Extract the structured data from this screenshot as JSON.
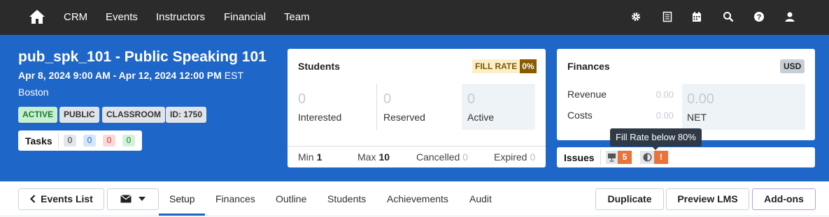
{
  "nav": {
    "home_icon": "home-icon",
    "links": [
      "CRM",
      "Events",
      "Instructors",
      "Financial",
      "Team"
    ],
    "icons": [
      "gear-icon",
      "document-icon",
      "calendar-icon",
      "search-icon",
      "help-icon",
      "user-icon"
    ]
  },
  "event": {
    "title": "pub_spk_101 - Public Speaking 101",
    "dates": "Apr 8, 2024 9:00 AM - Apr 12, 2024 12:00 PM",
    "timezone": "EST",
    "location": "Boston",
    "badges": [
      "ACTIVE",
      "PUBLIC",
      "CLASSROOM",
      "ID: 1750"
    ]
  },
  "tasks": {
    "label": "Tasks",
    "counts": [
      "0",
      "0",
      "0",
      "0"
    ]
  },
  "students": {
    "title": "Students",
    "fill_rate_label": "FILL RATE",
    "fill_rate_value": "0%",
    "stats": [
      {
        "value": "0",
        "label": "Interested"
      },
      {
        "value": "0",
        "label": "Reserved"
      },
      {
        "value": "0",
        "label": "Active"
      }
    ],
    "footer": {
      "min_label": "Min",
      "min_value": "1",
      "max_label": "Max",
      "max_value": "10",
      "cancelled_label": "Cancelled",
      "cancelled_value": "0",
      "expired_label": "Expired",
      "expired_value": "0"
    }
  },
  "finances": {
    "title": "Finances",
    "currency": "USD",
    "revenue_label": "Revenue",
    "revenue_value": "0.00",
    "costs_label": "Costs",
    "costs_value": "0.00",
    "net_value": "0.00",
    "net_label": "NET"
  },
  "tooltip": "Fill Rate below 80%",
  "issues": {
    "label": "Issues",
    "count": "5",
    "alert": "!"
  },
  "toolbar": {
    "events_list": "Events List",
    "tabs": [
      "Setup",
      "Finances",
      "Outline",
      "Students",
      "Achievements",
      "Audit"
    ],
    "duplicate": "Duplicate",
    "preview": "Preview LMS",
    "addons": "Add-ons"
  },
  "colors": {
    "topnav": "#2b2b2b",
    "band": "#1e66c8",
    "accent": "#1e66c8",
    "issue_orange": "#e8743b",
    "addons_border": "#b6a0d8"
  }
}
